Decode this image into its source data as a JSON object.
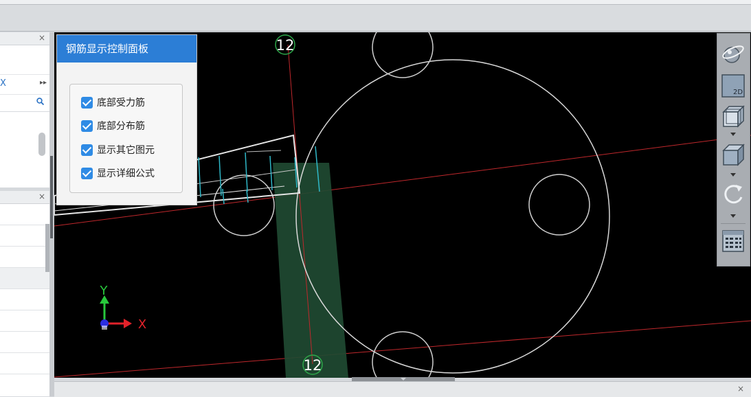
{
  "control_panel": {
    "title": "钢筋显示控制面板",
    "options": [
      {
        "label": "底部受力筋",
        "checked": true
      },
      {
        "label": "底部分布筋",
        "checked": true
      },
      {
        "label": "显示其它图元",
        "checked": true
      },
      {
        "label": "显示详细公式",
        "checked": true
      }
    ]
  },
  "viewport": {
    "axis_labels": {
      "top": "12",
      "bottom": "12"
    },
    "triad": {
      "y": "Y",
      "x": "X"
    }
  },
  "left_panel": {
    "close": "×",
    "expand_arrow": "▸▸",
    "partial_char": "X"
  },
  "left_panel_2": {
    "close": "×"
  },
  "bottom_panel": {
    "close": "×"
  },
  "toolbar": {
    "buttons": [
      "dynamic-observe",
      "2d-view",
      "3d-view",
      "3d-box-view",
      "rotate-view",
      "display-settings"
    ],
    "view_2d_label": "2D"
  },
  "colors": {
    "accent": "#2c7ed6",
    "viewport_bg": "#000000",
    "axis_red": "#c0282c",
    "rebar_cyan": "#2fb8c8",
    "column_green": "#1f4a32",
    "axis_circle_green": "#2da84a"
  }
}
